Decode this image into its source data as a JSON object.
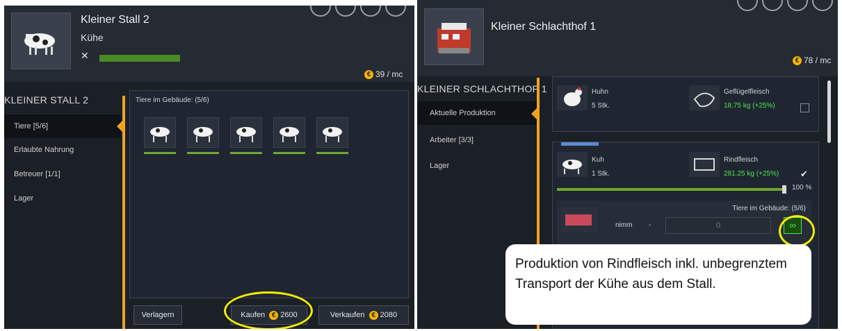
{
  "left": {
    "header": {
      "title": "Kleiner Stall 2",
      "subtitle": "Kühe",
      "money": "39 / mc",
      "health_level": 1.0
    },
    "sidebar_title": "KLEINER STALL 2",
    "nav": [
      "Tiere [5/6]",
      "Erlaubte Nahrung",
      "Betreuer [1/1]",
      "Lager"
    ],
    "animals_label": "Tiere im Gebäude: (5/6)",
    "animal_count": 5,
    "buttons": {
      "relocate": "Verlagern",
      "buy": "Kaufen",
      "buy_price": "2600",
      "sell": "Verkaufen",
      "sell_price": "2080"
    }
  },
  "right": {
    "header": {
      "title": "Kleiner Schlachthof 1",
      "money": "78 / mc"
    },
    "sidebar_title": "KLEINER SCHLACHTHOF 1",
    "nav": [
      "Aktuelle Produktion",
      "Arbeiter [3/3]",
      "Lager"
    ],
    "productions": [
      {
        "input_name": "Huhn",
        "input_qty": "5 Stk.",
        "output_name": "Geflügelfleisch",
        "output_amount": "18.75 kg  (+25%)",
        "checked": false
      },
      {
        "input_name": "Kuh",
        "input_qty": "1 Stk.",
        "output_name": "Rindfleisch",
        "output_amount": "281.25 kg  (+25%)",
        "checked": true,
        "percent": "100 %",
        "percent_value": 100
      }
    ],
    "transport": {
      "label": "Tiere im Gebäude: (5/6)",
      "take_label": "nimm",
      "minus": "-",
      "value": "0",
      "infinite_symbol": "∞"
    }
  },
  "callout": {
    "text": "Produktion von Rindfleisch inkl. unbegrenztem Transport der Kühe aus dem Stall."
  },
  "colors": {
    "accent": "#f0a21f",
    "highlight": "#f2ee00",
    "positive": "#4ee44e",
    "bar": "#6fa832"
  }
}
